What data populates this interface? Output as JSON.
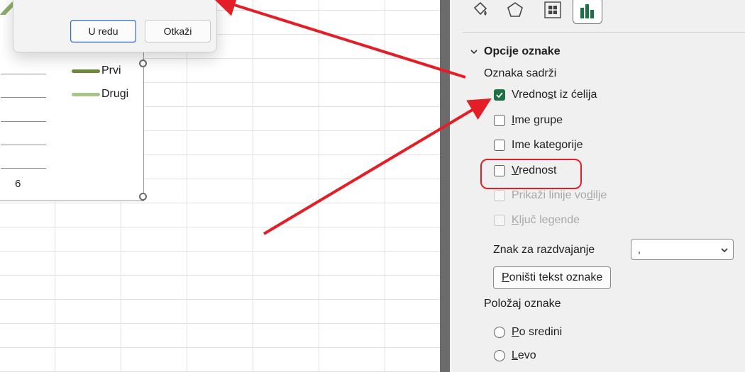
{
  "dialog": {
    "ok_label": "U redu",
    "cancel_label": "Otkaži"
  },
  "chart": {
    "legend": [
      {
        "name": "Prvi",
        "color": "#6e8b3d"
      },
      {
        "name": "Drugi",
        "color": "#a9c58c"
      }
    ],
    "axis_label": "6"
  },
  "pane": {
    "tabs": [
      "fill-line",
      "effects",
      "size-properties",
      "label-options"
    ],
    "section_title": "Opcije oznake",
    "contains_label": "Oznaka sadrži",
    "options": {
      "value_from_cells": {
        "pre": "Vredno",
        "ul": "s",
        "post": "t iz ćelija",
        "checked": true
      },
      "series_name": {
        "pre": "",
        "ul": "I",
        "post": "me grupe",
        "checked": false
      },
      "category_name": {
        "pre": "Ime kate",
        "ul": "g",
        "post": "orije",
        "checked": false
      },
      "value": {
        "pre": "",
        "ul": "V",
        "post": "rednost",
        "checked": false
      },
      "leader_lines": {
        "pre": "Prikaži linije vo",
        "ul": "d",
        "post": "ilje",
        "checked": false,
        "disabled": true
      },
      "legend_key": {
        "pre": "",
        "ul": "K",
        "post": "ljuč legende",
        "checked": false,
        "disabled": true
      }
    },
    "separator": {
      "pre": "Znak za razdvajan",
      "ul": "j",
      "post": "e",
      "value": ","
    },
    "reset_button": {
      "pre": "",
      "ul": "P",
      "post": "oništi tekst oznake"
    },
    "position_label": "Položaj oznake",
    "positions": {
      "center": {
        "pre": "",
        "ul": "P",
        "post": "o sredini"
      },
      "left": {
        "pre": "",
        "ul": "L",
        "post": "evo"
      }
    }
  },
  "colors": {
    "accent_green": "#1e7145",
    "annotation_red": "#e41e26"
  }
}
